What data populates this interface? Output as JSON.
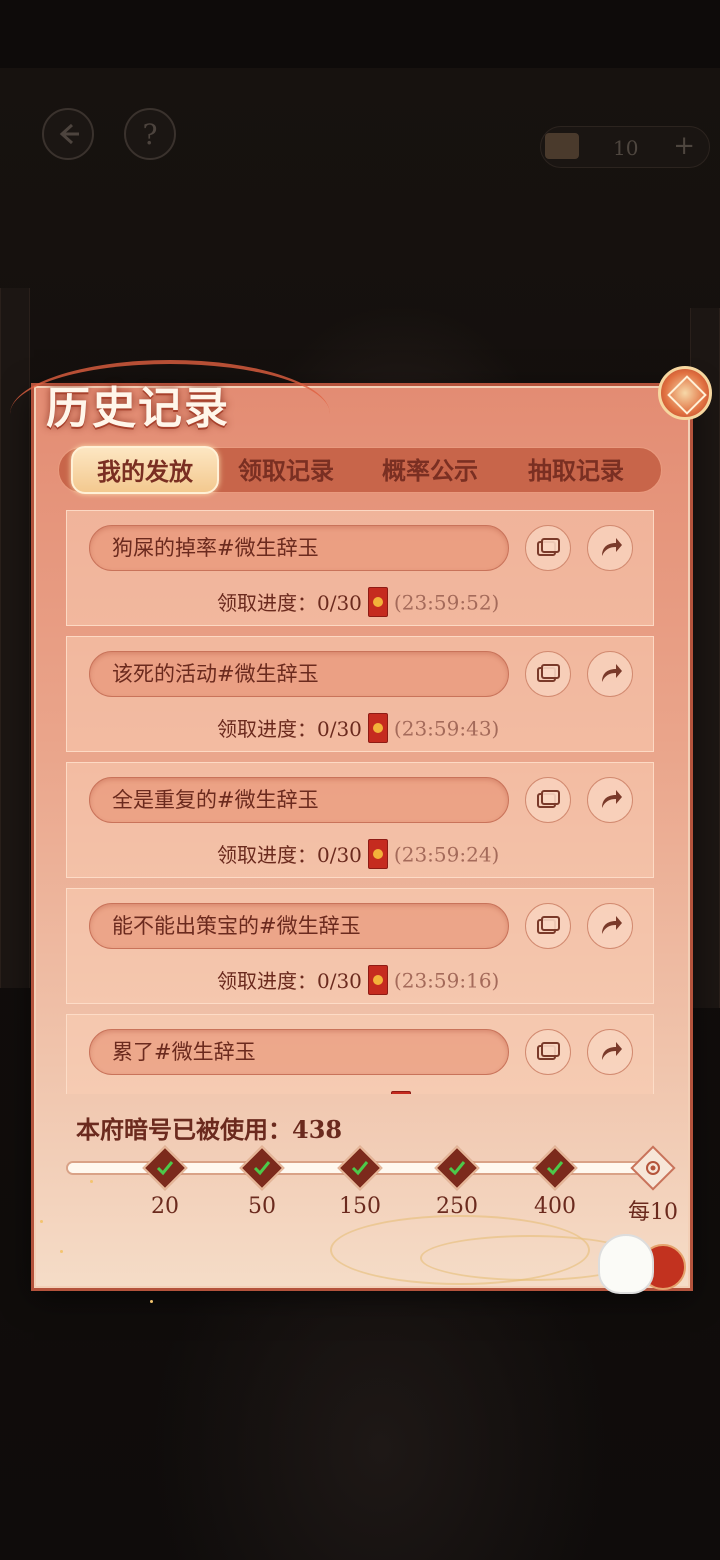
{
  "top_bar": {
    "back_icon": "back-arrow-icon",
    "help_label": "?",
    "currency_value": "10",
    "currency_plus": "+"
  },
  "panel": {
    "title": "历史记录"
  },
  "tabs": [
    {
      "label": "我的发放",
      "active": true
    },
    {
      "label": "领取记录",
      "active": false
    },
    {
      "label": "概率公示",
      "active": false
    },
    {
      "label": "抽取记录",
      "active": false
    }
  ],
  "records": [
    {
      "name": "狗屎的掉率#微生辞玉",
      "progress_label": "领取进度：0/30",
      "time": "(23:59:52)"
    },
    {
      "name": "该死的活动#微生辞玉",
      "progress_label": "领取进度：0/30",
      "time": "(23:59:43)"
    },
    {
      "name": "全是重复的#微生辞玉",
      "progress_label": "领取进度：0/30",
      "time": "(23:59:24)"
    },
    {
      "name": "能不能出策宝的#微生辞玉",
      "progress_label": "领取进度：0/30",
      "time": "(23:59:16)"
    },
    {
      "name": "累了#微生辞玉",
      "progress_label": "",
      "time": ""
    }
  ],
  "code_usage": {
    "text": "本府暗号已被使用：438"
  },
  "milestones": [
    {
      "label": "20",
      "claimed": true
    },
    {
      "label": "50",
      "claimed": true
    },
    {
      "label": "150",
      "claimed": true
    },
    {
      "label": "250",
      "claimed": true
    },
    {
      "label": "400",
      "claimed": true
    },
    {
      "label": "每10",
      "claimed": false
    }
  ],
  "colors": {
    "panel_top": "#e38c73",
    "panel_bottom": "#f5dcc7",
    "text_dark": "#6b2a1e",
    "tab_active": "#f3c98f",
    "check_green": "#4cc94a",
    "red_packet": "#c52b1f"
  }
}
